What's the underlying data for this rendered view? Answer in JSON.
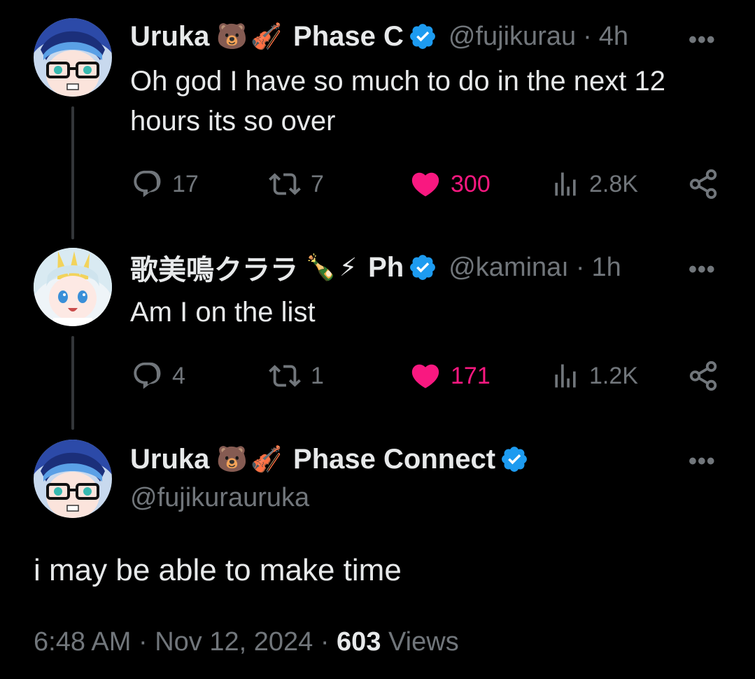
{
  "tweets": [
    {
      "name": "Uruka",
      "emojis": [
        "🐻",
        "🎻"
      ],
      "name_extra": "Phase C",
      "handle": "@fujikurau",
      "time": "4h",
      "text_lines": [
        "Oh god I have so much to do in the next 12",
        "hours its so over"
      ],
      "replies": "17",
      "reposts": "7",
      "likes": "300",
      "views": "2.8K"
    },
    {
      "name": "歌美鳴クララ",
      "emojis": [
        "🍾",
        "⚡"
      ],
      "name_extra": "Ph",
      "handle": "@kaminaı",
      "time": "1h",
      "text_lines": [
        "Am I on the list"
      ],
      "replies": "4",
      "reposts": "1",
      "likes": "171",
      "views": "1.2K"
    }
  ],
  "main": {
    "name": "Uruka",
    "emojis": [
      "🐻",
      "🎻"
    ],
    "name_extra": "Phase Connect",
    "handle": "@fujikurauruka",
    "text": "i may be able to make time",
    "time": "6:48 AM",
    "date": "Nov 12, 2024",
    "views_count": "603",
    "views_label": "Views"
  },
  "ui": {
    "dot": "·",
    "more": "•••"
  },
  "colors": {
    "like": "#f91880",
    "verified": "#1d9bf0",
    "muted": "#71767b"
  },
  "icons": [
    "reply-icon",
    "repost-icon",
    "heart-icon",
    "views-icon",
    "share-icon",
    "verified-badge-icon",
    "more-icon"
  ]
}
